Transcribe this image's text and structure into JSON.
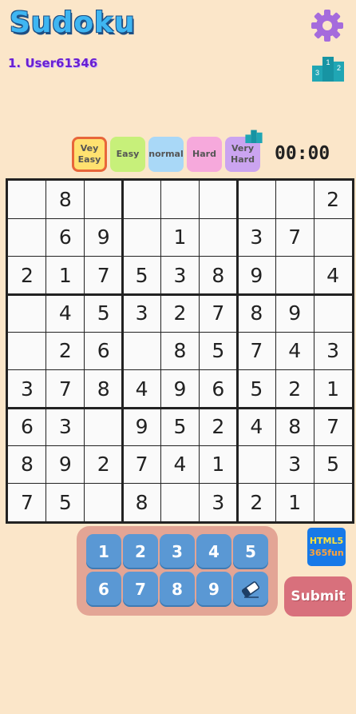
{
  "app": {
    "title": "Sudoku",
    "user": "1. User61346"
  },
  "header": {
    "settings_icon": "gear-icon",
    "leaderboard_icon": "podium-icon",
    "podium_ranks": [
      "3",
      "1",
      "2"
    ]
  },
  "difficulty": {
    "levels": [
      {
        "label": "Vey\nEasy",
        "color": "#ffe170",
        "selected": true
      },
      {
        "label": "Easy",
        "color": "#c7f07a",
        "selected": false
      },
      {
        "label": "normal",
        "color": "#a9d8f7",
        "selected": false
      },
      {
        "label": "Hard",
        "color": "#f6a9dc",
        "selected": false
      },
      {
        "label": "Very\nHard",
        "color": "#cba4f0",
        "selected": false
      }
    ],
    "selected_border": "#e8663a"
  },
  "timer": "00:00",
  "board": [
    [
      "",
      "8",
      "",
      "",
      "",
      "",
      "",
      "",
      "2"
    ],
    [
      "",
      "6",
      "9",
      "",
      "1",
      "",
      "3",
      "7",
      ""
    ],
    [
      "2",
      "1",
      "7",
      "5",
      "3",
      "8",
      "9",
      "",
      "4"
    ],
    [
      "",
      "4",
      "5",
      "3",
      "2",
      "7",
      "8",
      "9",
      ""
    ],
    [
      "",
      "2",
      "6",
      "",
      "8",
      "5",
      "7",
      "4",
      "3"
    ],
    [
      "3",
      "7",
      "8",
      "4",
      "9",
      "6",
      "5",
      "2",
      "1"
    ],
    [
      "6",
      "3",
      "",
      "9",
      "5",
      "2",
      "4",
      "8",
      "7"
    ],
    [
      "8",
      "9",
      "2",
      "7",
      "4",
      "1",
      "",
      "3",
      "5"
    ],
    [
      "7",
      "5",
      "",
      "8",
      "",
      "3",
      "2",
      "1",
      ""
    ]
  ],
  "keypad": {
    "keys": [
      "1",
      "2",
      "3",
      "4",
      "5",
      "6",
      "7",
      "8",
      "9"
    ],
    "erase_icon": "eraser-icon"
  },
  "branding": {
    "line1": "HTML5",
    "line2": "365fun"
  },
  "actions": {
    "submit_label": "Submit"
  }
}
